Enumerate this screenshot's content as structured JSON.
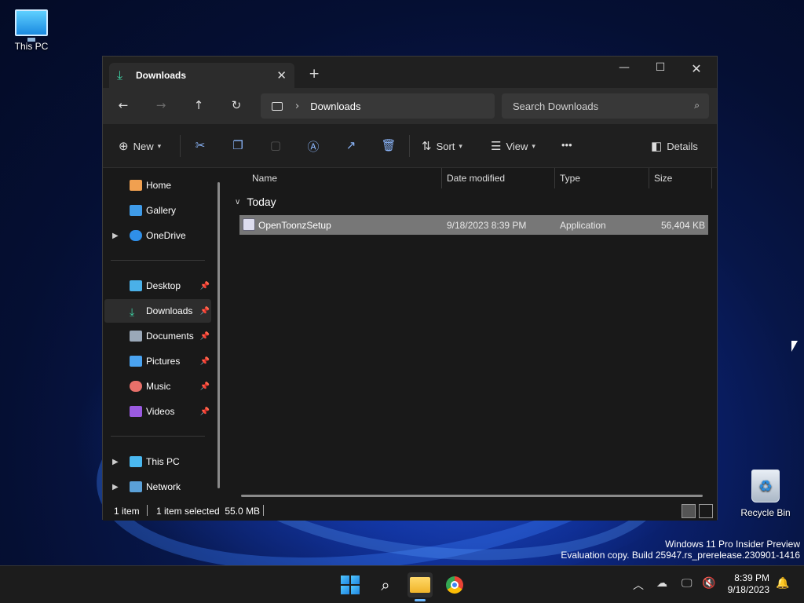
{
  "desktop": {
    "icons": [
      {
        "label": "This PC"
      },
      {
        "label": "Recycle Bin"
      }
    ],
    "watermark": {
      "line1": "Windows 11 Pro Insider Preview",
      "line2": "Evaluation copy. Build 25947.rs_prerelease.230901-1416"
    }
  },
  "window": {
    "tab": {
      "label": "Downloads",
      "icon": "download-icon"
    },
    "controls": {
      "minimize": "—",
      "maximize": "☐",
      "close": "✕",
      "new_tab": "+"
    },
    "address": {
      "crumb": "Downloads"
    },
    "search": {
      "placeholder": "Search Downloads"
    },
    "toolbar": {
      "new_label": "New",
      "sort_label": "Sort",
      "view_label": "View",
      "more_label": "•••",
      "details_label": "Details"
    },
    "sidebar": {
      "items": [
        {
          "label": "Home"
        },
        {
          "label": "Gallery"
        },
        {
          "label": "OneDrive"
        },
        {
          "label": "Desktop"
        },
        {
          "label": "Downloads"
        },
        {
          "label": "Documents"
        },
        {
          "label": "Pictures"
        },
        {
          "label": "Music"
        },
        {
          "label": "Videos"
        },
        {
          "label": "This PC"
        },
        {
          "label": "Network"
        }
      ]
    },
    "columns": {
      "name": "Name",
      "date": "Date modified",
      "type": "Type",
      "size": "Size"
    },
    "group": {
      "label": "Today"
    },
    "files": [
      {
        "name": "OpenToonzSetup",
        "date": "9/18/2023 8:39 PM",
        "type": "Application",
        "size": "56,404 KB"
      }
    ],
    "status": {
      "count": "1 item",
      "selected": "1 item selected  55.0 MB"
    }
  },
  "taskbar": {
    "clock": {
      "time": "8:39 PM",
      "date": "9/18/2023"
    }
  }
}
